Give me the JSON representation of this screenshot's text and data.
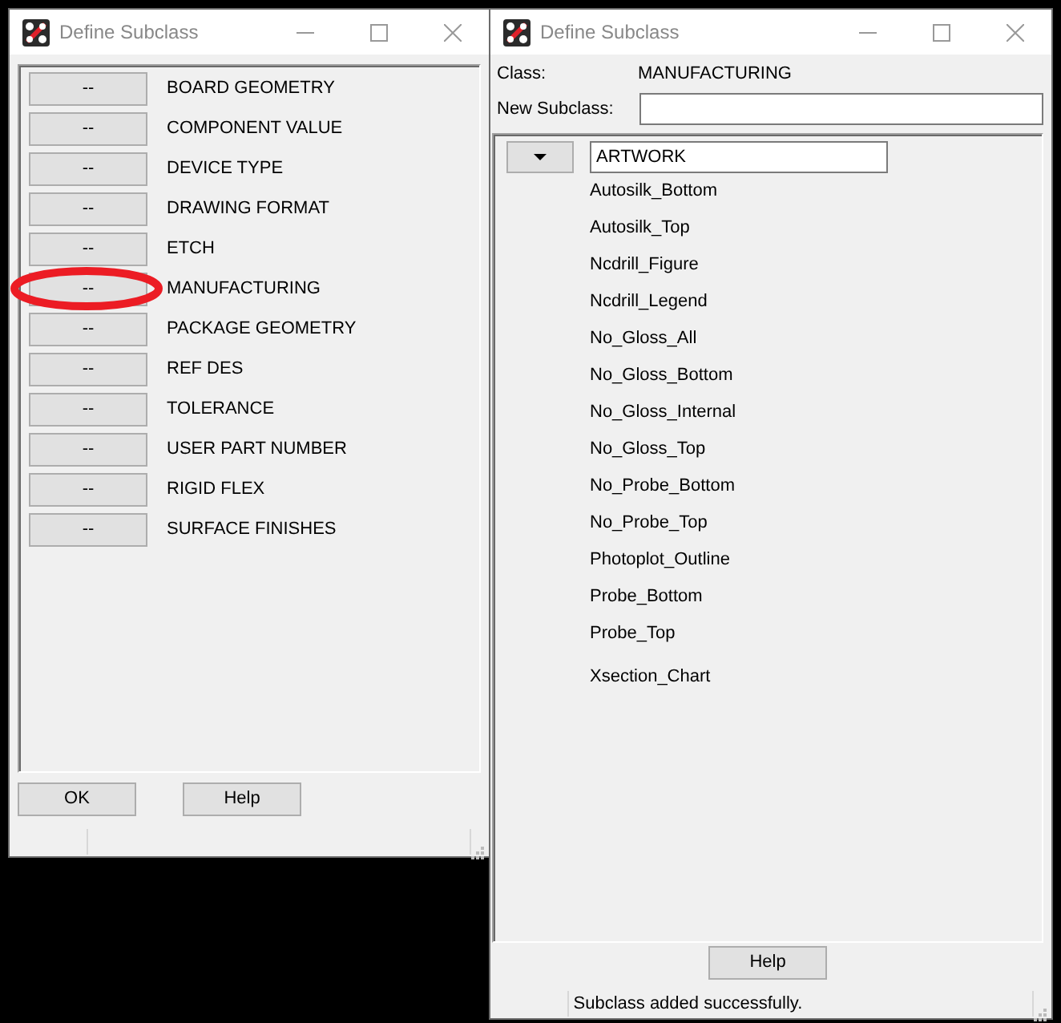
{
  "windows": [
    {
      "title": "Define Subclass",
      "classes": [
        {
          "button": "--",
          "label": "BOARD GEOMETRY",
          "highlighted": false
        },
        {
          "button": "--",
          "label": "COMPONENT VALUE",
          "highlighted": false
        },
        {
          "button": "--",
          "label": "DEVICE TYPE",
          "highlighted": false
        },
        {
          "button": "--",
          "label": "DRAWING FORMAT",
          "highlighted": false
        },
        {
          "button": "--",
          "label": "ETCH",
          "highlighted": false
        },
        {
          "button": "--",
          "label": "MANUFACTURING",
          "highlighted": true
        },
        {
          "button": "--",
          "label": "PACKAGE GEOMETRY",
          "highlighted": false
        },
        {
          "button": "--",
          "label": "REF DES",
          "highlighted": false
        },
        {
          "button": "--",
          "label": "TOLERANCE",
          "highlighted": false
        },
        {
          "button": "--",
          "label": "USER PART NUMBER",
          "highlighted": false
        },
        {
          "button": "--",
          "label": "RIGID FLEX",
          "highlighted": false
        },
        {
          "button": "--",
          "label": "SURFACE FINISHES",
          "highlighted": false
        }
      ],
      "buttons": [
        "OK",
        "Help"
      ]
    },
    {
      "title": "Define Subclass",
      "class_label": "Class:",
      "class_value": "MANUFACTURING",
      "new_subclass_label": "New Subclass:",
      "first_subclass": "ARTWORK",
      "subclasses": [
        "Autosilk_Bottom",
        "Autosilk_Top",
        "Ncdrill_Figure",
        "Ncdrill_Legend",
        "No_Gloss_All",
        "No_Gloss_Bottom",
        "No_Gloss_Internal",
        "No_Gloss_Top",
        "No_Probe_Bottom",
        "No_Probe_Top",
        "Photoplot_Outline",
        "Probe_Bottom",
        "Probe_Top",
        "Xsection_Chart"
      ],
      "buttons": [
        "Help"
      ],
      "status": "Subclass added successfully."
    }
  ]
}
